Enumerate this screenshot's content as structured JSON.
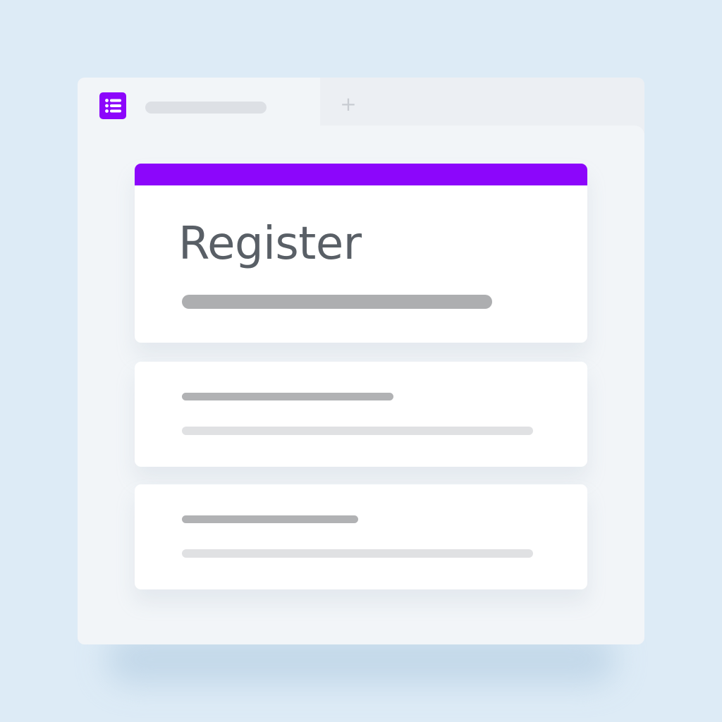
{
  "window": {
    "app_icon": "form-list-icon",
    "new_tab_label": "+"
  },
  "form": {
    "title": "Register"
  },
  "colors": {
    "accent": "#8c06fb",
    "background": "#ddebf6"
  }
}
